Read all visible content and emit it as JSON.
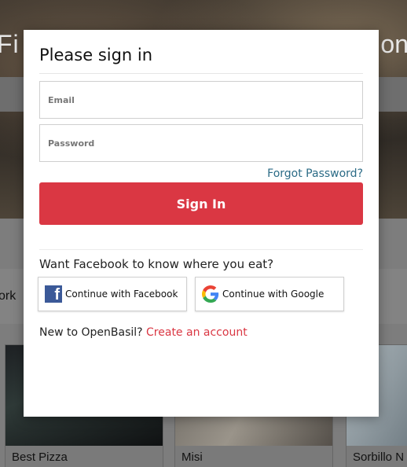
{
  "background": {
    "hero_left_text": "Fi",
    "hero_right_text": "on",
    "side_text": "ork",
    "cards": [
      {
        "caption": "Best Pizza"
      },
      {
        "caption": "Misi"
      },
      {
        "caption": "Sorbillo N"
      }
    ]
  },
  "modal": {
    "title": "Please sign in",
    "email": {
      "placeholder": "Email",
      "value": ""
    },
    "password": {
      "placeholder": "Password",
      "value": ""
    },
    "forgot_link": "Forgot Password?",
    "signin_button": "Sign In",
    "social_prompt": "Want Facebook to know where you eat?",
    "facebook_button": "Continue with Facebook",
    "google_button": "Continue with Google",
    "signup_prompt": "New to OpenBasil?",
    "create_account_link": "Create an account",
    "icons": {
      "facebook": "facebook-icon",
      "google": "google-icon"
    }
  },
  "colors": {
    "primary_red": "#da3743",
    "link_blue": "#2b6b86",
    "facebook_blue": "#3b5998"
  }
}
